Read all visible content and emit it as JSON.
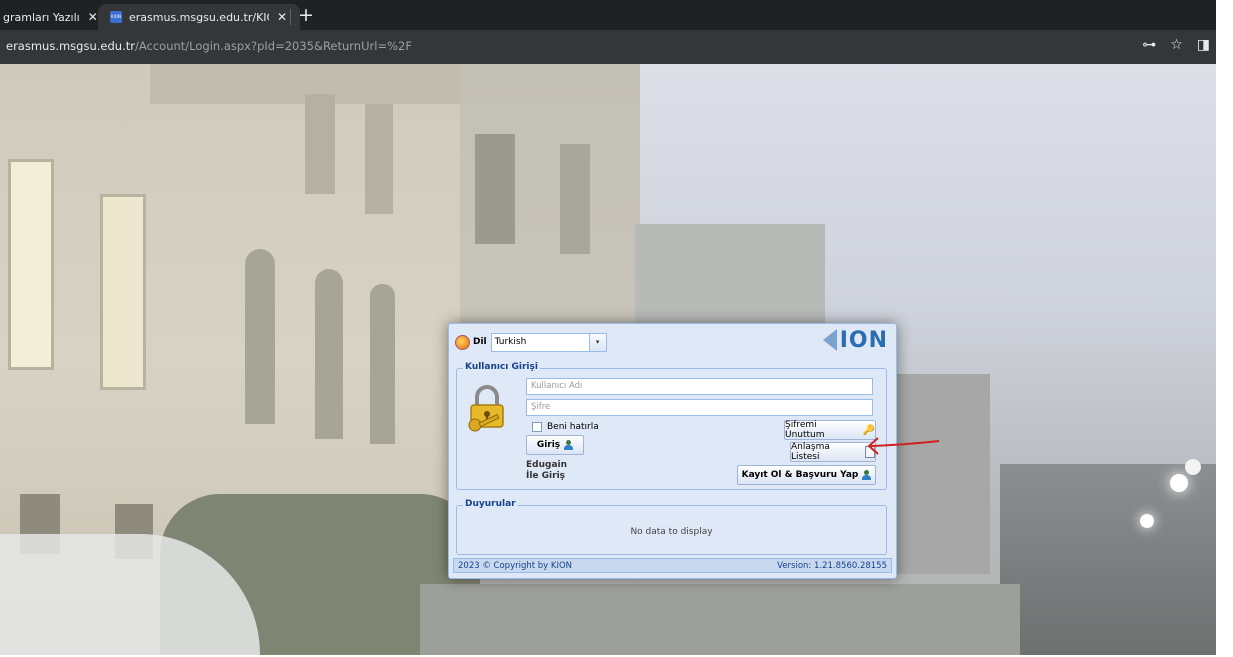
{
  "browser": {
    "tabs": [
      {
        "title": "gramları Yazılı"
      },
      {
        "title": "erasmus.msgsu.edu.tr/KION.UI.V"
      }
    ],
    "new_tab": "+",
    "url_domain": "erasmus.msgsu.edu.tr",
    "url_path": "/Account/Login.aspx?pId=2035&ReturnUrl=%2F"
  },
  "language": {
    "label": "Dil",
    "selected": "Turkish"
  },
  "logo_text": "ION",
  "login": {
    "legend": "Kullanıcı Girişi",
    "username_placeholder": "Kullanıcı Adı",
    "password_placeholder": "Şifre",
    "remember_label": "Beni hatırla",
    "login_button": "Giriş",
    "edugain_line1": "Edugain",
    "edugain_line2": "İle Giriş",
    "forgot_button": "Şifremi Unuttum",
    "agreements_button": "Anlaşma Listesi",
    "register_button": "Kayıt Ol & Başvuru Yap"
  },
  "announcements": {
    "legend": "Duyurular",
    "empty_text": "No data to display"
  },
  "footer": {
    "copyright": "2023 © Copyright by KION",
    "version": "Version: 1.21.8560.28155"
  },
  "colors": {
    "panel_bg": "#dfe8f6",
    "panel_border": "#99bbe8",
    "legend_text": "#15428b",
    "annotation_arrow": "#d01f1f"
  }
}
